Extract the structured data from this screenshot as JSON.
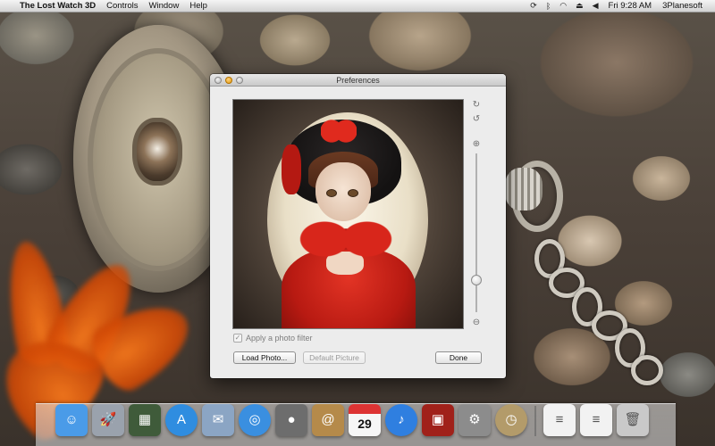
{
  "menubar": {
    "apple_glyph": "",
    "app_name": "The Lost Watch 3D",
    "menus": [
      "Controls",
      "Window",
      "Help"
    ],
    "clock": "Fri 9:28 AM",
    "user": "3Planesoft",
    "status_icons": [
      "sync-icon",
      "bluetooth-icon",
      "wifi-icon",
      "eject-icon",
      "volume-icon"
    ]
  },
  "preferences": {
    "title": "Preferences",
    "apply_filter_label": "Apply a photo filter",
    "apply_filter_checked": true,
    "load_photo_label": "Load Photo...",
    "default_picture_label": "Default Picture",
    "done_label": "Done",
    "zoom_level": 0.2
  },
  "dock": {
    "items": [
      {
        "name": "finder-icon",
        "color": "#4a9be8"
      },
      {
        "name": "launchpad-icon",
        "color": "#9aa2ad"
      },
      {
        "name": "mission-control-icon",
        "color": "#3f5b3a"
      },
      {
        "name": "app-store-icon",
        "color": "#2f8de0"
      },
      {
        "name": "mail-icon",
        "color": "#8ba5c4"
      },
      {
        "name": "safari-icon",
        "color": "#3a8fe0"
      },
      {
        "name": "facetime-icon",
        "color": "#6d6d6d"
      },
      {
        "name": "address-book-icon",
        "color": "#b58a4a"
      },
      {
        "name": "calendar-icon",
        "color": "#f0f0f0"
      },
      {
        "name": "itunes-icon",
        "color": "#2f7fe0"
      },
      {
        "name": "photo-booth-icon",
        "color": "#a0211a"
      },
      {
        "name": "system-preferences-icon",
        "color": "#8c8c8c"
      },
      {
        "name": "lost-watch-icon",
        "color": "#b39b6a"
      },
      {
        "name": "document-icon",
        "color": "#f2f2f2"
      },
      {
        "name": "document-icon-2",
        "color": "#f2f2f2"
      },
      {
        "name": "trash-icon",
        "color": "#c9c9c9"
      }
    ],
    "calendar_day": "29"
  }
}
